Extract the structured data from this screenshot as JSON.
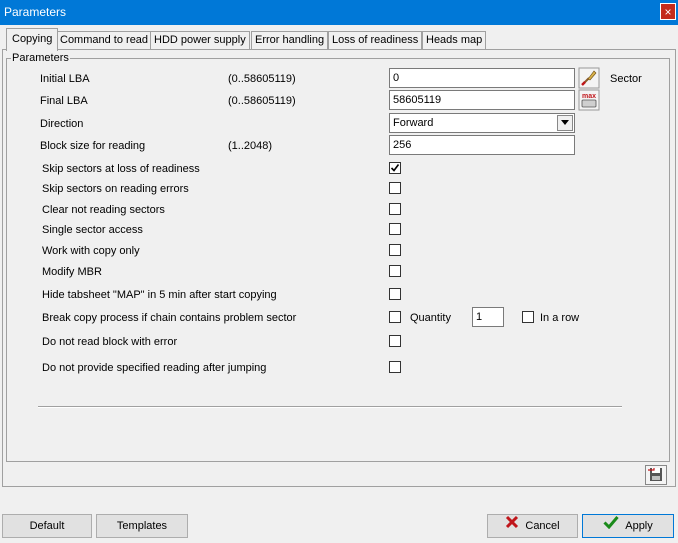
{
  "window": {
    "title": "Parameters",
    "close_glyph": "×"
  },
  "tabs": [
    {
      "label": "Copying",
      "active": true
    },
    {
      "label": "Command to read"
    },
    {
      "label": "HDD power supply"
    },
    {
      "label": "Error handling"
    },
    {
      "label": "Loss of readiness"
    },
    {
      "label": "Heads map"
    }
  ],
  "group": {
    "legend": "Parameters"
  },
  "fields": {
    "initial_lba": {
      "label": "Initial LBA",
      "range": "(0..58605119)",
      "value": "0",
      "unit": "Sector"
    },
    "final_lba": {
      "label": "Final  LBA",
      "range": "(0..58605119)",
      "value": "58605119",
      "max_icon_text": "max"
    },
    "direction": {
      "label": "Direction",
      "value": "Forward"
    },
    "block_size": {
      "label": "Block size for reading",
      "range": "(1..2048)",
      "value": "256"
    }
  },
  "checkboxes": [
    {
      "label": "Skip sectors at loss of readiness",
      "checked": true
    },
    {
      "label": "Skip sectors on reading errors",
      "checked": false
    },
    {
      "label": "Clear not reading sectors",
      "checked": false
    },
    {
      "label": "Single sector access",
      "checked": false
    },
    {
      "label": "Work with copy only",
      "checked": false
    },
    {
      "label": "Modify MBR",
      "checked": false
    },
    {
      "label": "Hide tabsheet \"MAP\" in 5 min after start copying",
      "checked": false
    },
    {
      "label": "Break copy process if chain contains problem sector",
      "checked": false
    },
    {
      "label": "Do not read block with error",
      "checked": false
    },
    {
      "label": "Do not provide specified reading after jumping",
      "checked": false
    }
  ],
  "break_chain": {
    "quantity_label": "Quantity",
    "quantity_value": "1",
    "in_a_row_label": "In a row",
    "in_a_row_checked": false
  },
  "buttons": {
    "default": "Default",
    "templates": "Templates",
    "cancel": "Cancel",
    "apply": "Apply"
  },
  "icons": {
    "clear": "eraser-icon",
    "max": "max-icon",
    "save": "save-icon",
    "cancel": "red-x-icon",
    "apply": "green-check-icon"
  },
  "colors": {
    "titlebar": "#0078d7",
    "close": "#c42b1c",
    "cancel_x": "#c0161b",
    "apply_check": "#1a8a1a"
  }
}
